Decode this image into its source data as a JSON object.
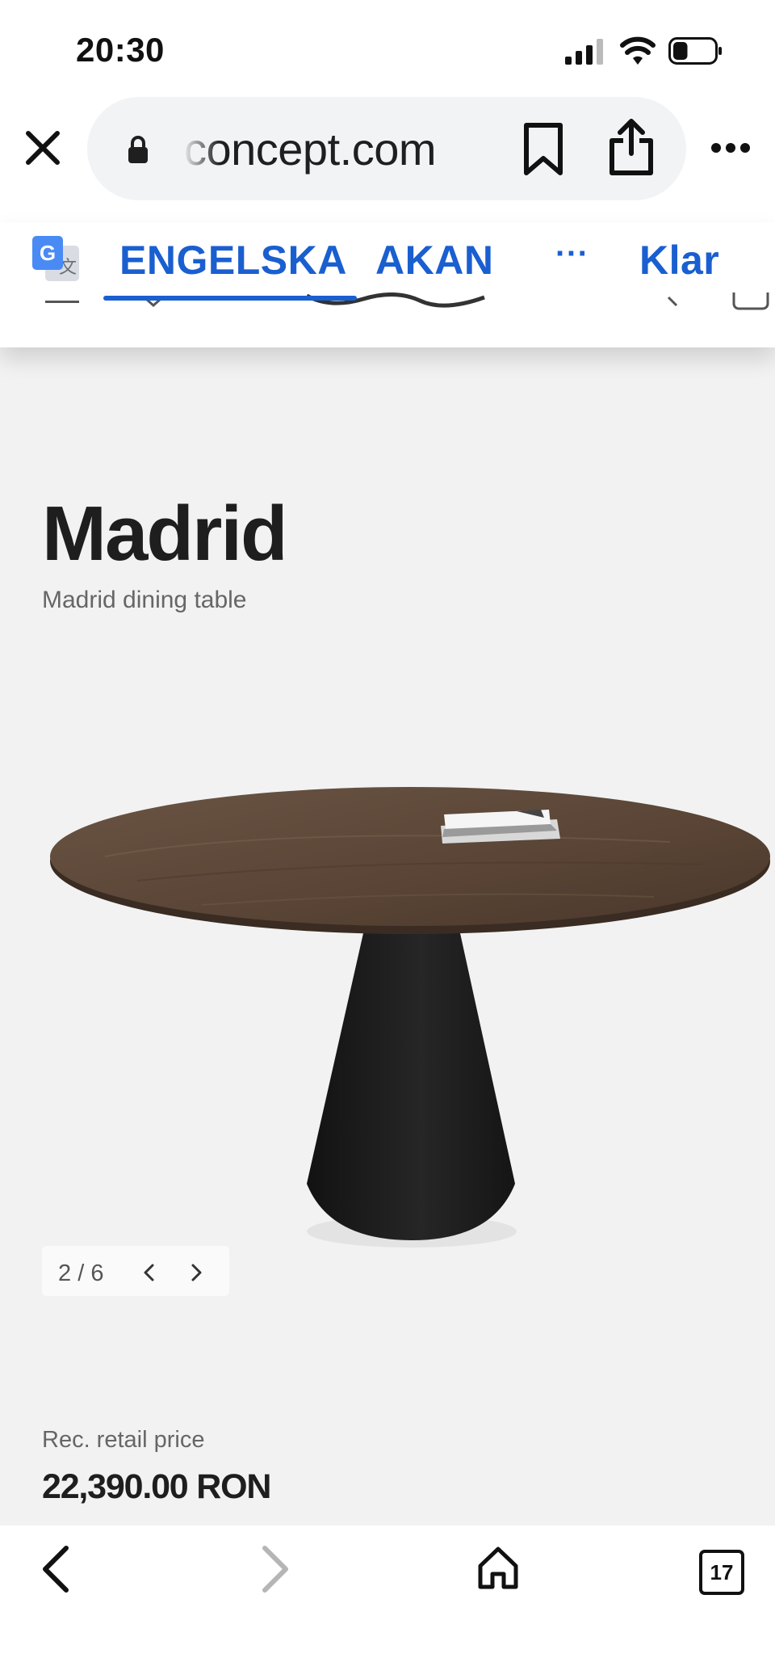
{
  "status_bar": {
    "time": "20:30",
    "battery_level": 0.35
  },
  "browser": {
    "url_display": "concept.com",
    "close_icon": "close-icon",
    "lock_icon": "lock-icon",
    "bookmark_icon": "bookmark-icon",
    "share_icon": "share-icon",
    "more_icon": "more-horizontal-icon"
  },
  "translate": {
    "icon": "google-translate-icon",
    "source_language": "ENGELSKA",
    "target_language": "AKAN",
    "more_label": "···",
    "done_label": "Klar"
  },
  "product": {
    "name": "Madrid",
    "description": "Madrid dining table",
    "image": "madrid-dining-table",
    "gallery": {
      "current": "2",
      "separator": "/",
      "total": "6"
    },
    "price_label": "Rec. retail price",
    "price": "22,390.00 RON"
  },
  "toolbar": {
    "back_icon": "back-icon",
    "forward_icon": "forward-icon",
    "home_icon": "home-icon",
    "tabs_count": "17"
  },
  "colors": {
    "accent": "#1a5fd0",
    "page_background": "#f2f2f2",
    "text": "#1e1e1e",
    "tabletop": "#5b4636",
    "table_base": "#1c1c1c"
  }
}
